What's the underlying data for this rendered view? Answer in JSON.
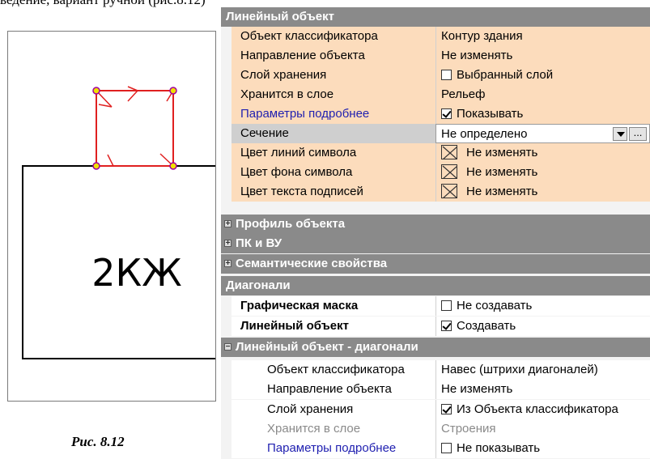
{
  "page": {
    "top_text": "ведение, вариант ручной (рис.8.12)"
  },
  "figure": {
    "label": "2КЖ",
    "caption": "Рис. 8.12"
  },
  "panel": {
    "header1": "Линейный объект",
    "props1": [
      {
        "name": "Объект классификатора",
        "value": "Контур здания"
      },
      {
        "name": "Направление объекта",
        "value": "Не изменять"
      },
      {
        "name": "Слой хранения",
        "value": "Выбранный слой",
        "checked": false
      },
      {
        "name": "Хранится в слое",
        "value": "Рельеф"
      },
      {
        "name": "Параметры подробнее",
        "value": "Показывать",
        "checked": true
      },
      {
        "name": "Сечение",
        "value": "Не определено",
        "button": "..."
      },
      {
        "name": "Цвет линий символа",
        "value": "Не изменять"
      },
      {
        "name": "Цвет фона символа",
        "value": "Не изменять"
      },
      {
        "name": "Цвет текста подписей",
        "value": "Не изменять"
      }
    ],
    "groups": [
      {
        "label": "Профиль объекта",
        "sign": "+"
      },
      {
        "label": "ПК и ВУ",
        "sign": "+"
      },
      {
        "label": "Семантические свойства",
        "sign": "+"
      }
    ],
    "header2": "Диагонали",
    "props2": [
      {
        "name": "Графическая маска",
        "value": "Не создавать",
        "checked": false
      },
      {
        "name": "Линейный объект",
        "value": "Создавать",
        "checked": true
      }
    ],
    "group4": {
      "label": "Линейный объект - диагонали",
      "sign": "−"
    },
    "props3": [
      {
        "name": "Объект классификатора",
        "value": "Навес (штрихи диагоналей)"
      },
      {
        "name": "Направление объекта",
        "value": "Не изменять"
      },
      {
        "name": "Слой хранения",
        "value": "Из Объекта классификатора",
        "checked": true
      },
      {
        "name": "Хранится в слое",
        "value": "Строения"
      },
      {
        "name": "Параметры подробнее",
        "value": "Не показывать",
        "checked": false
      }
    ]
  }
}
